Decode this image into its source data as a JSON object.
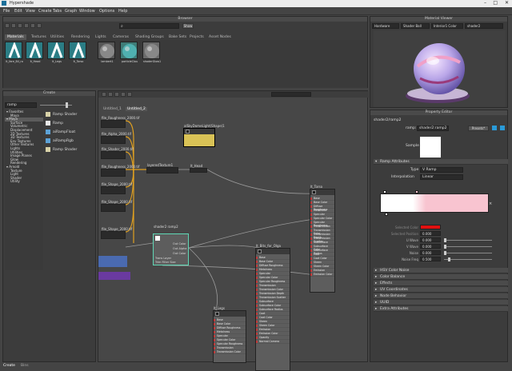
{
  "title": "Hypershade",
  "menu": [
    "File",
    "Edit",
    "View",
    "Create",
    "Tabs",
    "Graph",
    "Window",
    "Options",
    "Help"
  ],
  "browser": {
    "header": "Browser",
    "search_placeholder": "",
    "show_label": "Show",
    "tabs": [
      "Materials",
      "Textures",
      "Utilities",
      "Rendering",
      "Lights",
      "Cameras",
      "Shading Groups",
      "Bake Sets",
      "Projects",
      "Asset Nodes"
    ],
    "swatches": [
      {
        "label": "lt_fare_Bil_ro",
        "color": "#2b7d85"
      },
      {
        "label": "lt_Head",
        "color": "#2b7d85"
      },
      {
        "label": "lt_Legs",
        "color": "#2b7d85"
      },
      {
        "label": "lt_Torso",
        "color": "#2b7d85"
      },
      {
        "label": "lambert1",
        "color": "#575757"
      },
      {
        "label": "particleClou",
        "color": "#3f7c78"
      },
      {
        "label": "shaderGlow1",
        "color": "#6a6a6a"
      }
    ]
  },
  "material_viewer": {
    "header": "Material Viewer",
    "renderer": "Hardware",
    "ball": "Shader Ball",
    "env": "Interior1 Color",
    "shader": "shader2"
  },
  "create": {
    "header": "Create",
    "search_value": "ramp",
    "tree": [
      {
        "label": "Favorites",
        "level": 0
      },
      {
        "label": "Maya",
        "level": 1
      },
      {
        "label": "Maya",
        "level": 0
      },
      {
        "label": "Surface",
        "level": 1
      },
      {
        "label": "Volumetric",
        "level": 1
      },
      {
        "label": "Displacement",
        "level": 1
      },
      {
        "label": "2D Textures",
        "level": 1
      },
      {
        "label": "3D Textures",
        "level": 1
      },
      {
        "label": "Env Textures",
        "level": 1
      },
      {
        "label": "Other Textures",
        "level": 1
      },
      {
        "label": "Lights",
        "level": 1
      },
      {
        "label": "Utilities",
        "level": 1
      },
      {
        "label": "Image Planes",
        "level": 1
      },
      {
        "label": "Glow",
        "level": 1
      },
      {
        "label": "Rendering",
        "level": 1
      },
      {
        "label": "Arnold",
        "level": 0
      },
      {
        "label": "Texture",
        "level": 1
      },
      {
        "label": "Light",
        "level": 1
      },
      {
        "label": "Shader",
        "level": 1
      },
      {
        "label": "Utility",
        "level": 1
      }
    ],
    "results": [
      "Ramp Shader",
      "Ramp",
      "aiRampFloat",
      "aiRampRgb",
      "Ramp Shader"
    ]
  },
  "graph": {
    "tabs": [
      "Untitled_1",
      "Untitled_2"
    ],
    "nodes": {
      "n1": "file_Roughness_2000.tif",
      "n2": "file_Alpha_2000.tif",
      "n3": "file_Shader_2000.tif",
      "n4": "file_Roughness_2000.tif",
      "n5": "file_Shape_2000.tif",
      "n6": "file_Shape_2000.tif",
      "n7": "file_Shape_2000.tif",
      "n8": "alSkyDomeLight(Shape)1",
      "n9": "layeredTexture1",
      "n10": "lt_Head",
      "n11": "shader2",
      "n12": "lt_Torso",
      "n13": "lt_Bits_for_Olga",
      "n14": "lt_Legs"
    },
    "sd": {
      "header": "shader2 ramp2",
      "p1": "Out Color",
      "p2": "Out Alpha",
      "p3": "Out Color",
      "p4": "Trans Layer",
      "p5": "Trim Filter Size"
    }
  },
  "bottom_tabs": [
    "Create",
    "Bins"
  ],
  "property": {
    "header": "Property Editor",
    "tabs": [
      "shader2",
      "ramp2"
    ],
    "node_label": "ramp:",
    "node_value": "shader2:ramp2",
    "presets": "Presets*",
    "sample": "Sample",
    "section": "Ramp Attributes",
    "type_label": "Type",
    "type_value": "V Ramp",
    "interp_label": "Interpolation",
    "interp_value": "Linear",
    "fields": [
      {
        "label": "Selected Color",
        "value": ""
      },
      {
        "label": "Selected Position",
        "value": "0.000"
      },
      {
        "label": "U Wave",
        "value": "0.000"
      },
      {
        "label": "V Wave",
        "value": "0.000"
      },
      {
        "label": "Noise",
        "value": "0.000"
      },
      {
        "label": "Noise Freq",
        "value": "0.500"
      }
    ],
    "sections": [
      "HSV Color Noise",
      "Color Balance",
      "Effects",
      "UV Coordinates",
      "Node Behavior",
      "UUID",
      "Extra Attributes"
    ],
    "ramp_colors": [
      "#ffffff",
      "#f8c4d0"
    ],
    "selected_color": "#e01010"
  }
}
